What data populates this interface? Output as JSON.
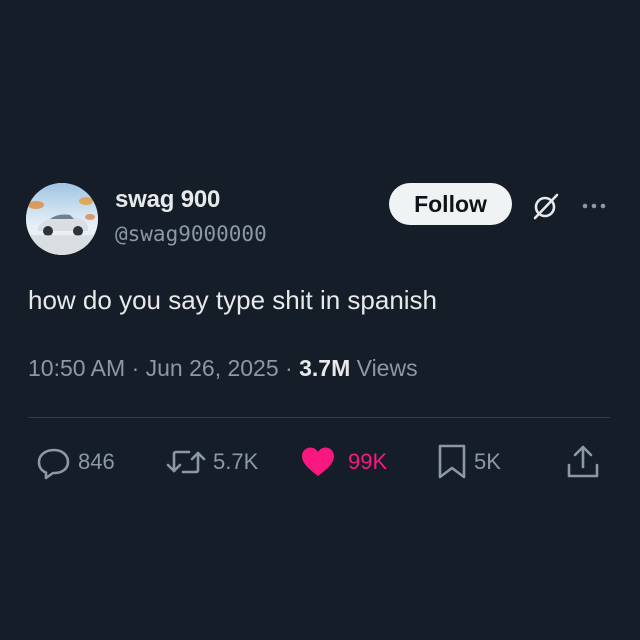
{
  "author": {
    "display_name": "swag 900",
    "handle": "@swag9000000"
  },
  "header": {
    "follow_label": "Follow",
    "grok_icon": "grok-slash-icon",
    "more_icon": "more-dots-icon"
  },
  "tweet": {
    "text": "how do you say type shit in spanish",
    "time": "10:50 AM",
    "date": "Jun 26, 2025",
    "views_count": "3.7M",
    "views_label": "Views"
  },
  "actions": {
    "replies": "846",
    "reposts": "5.7K",
    "likes": "99K",
    "liked": true,
    "bookmarks": "5K"
  },
  "colors": {
    "background": "#151d28",
    "text_primary": "#e7e9ea",
    "text_secondary": "#8b98a5",
    "like_active": "#f91880",
    "follow_bg": "#eff3f4"
  }
}
